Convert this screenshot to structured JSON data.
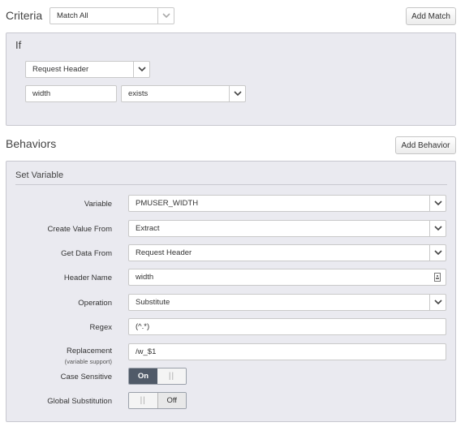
{
  "criteria": {
    "title": "Criteria",
    "match_select": "Match All",
    "add_match_label": "Add Match"
  },
  "if_panel": {
    "title": "If",
    "condition_type": "Request Header",
    "header_name": "width",
    "operator": "exists"
  },
  "behaviors": {
    "title": "Behaviors",
    "add_behavior_label": "Add Behavior",
    "set_variable": {
      "title": "Set Variable",
      "fields": {
        "variable": {
          "label": "Variable",
          "value": "PMUSER_WIDTH"
        },
        "create_value_from": {
          "label": "Create Value From",
          "value": "Extract"
        },
        "get_data_from": {
          "label": "Get Data From",
          "value": "Request Header"
        },
        "header_name": {
          "label": "Header Name",
          "value": "width"
        },
        "operation": {
          "label": "Operation",
          "value": "Substitute"
        },
        "regex": {
          "label": "Regex",
          "value": "(^.*)"
        },
        "replacement": {
          "label": "Replacement",
          "sublabel": "(variable support)",
          "value": "/w_$1"
        },
        "case_sensitive": {
          "label": "Case Sensitive",
          "state": "On"
        },
        "global_substitution": {
          "label": "Global Substitution",
          "state": "Off"
        }
      }
    }
  },
  "icons": {
    "chevron": "chevron-down-icon",
    "variable_picker": "variable-picker-icon",
    "grip": "toggle-grip-icon"
  },
  "colors": {
    "panel_bg": "#eaeaf0",
    "toggle_on": "#505a68"
  }
}
